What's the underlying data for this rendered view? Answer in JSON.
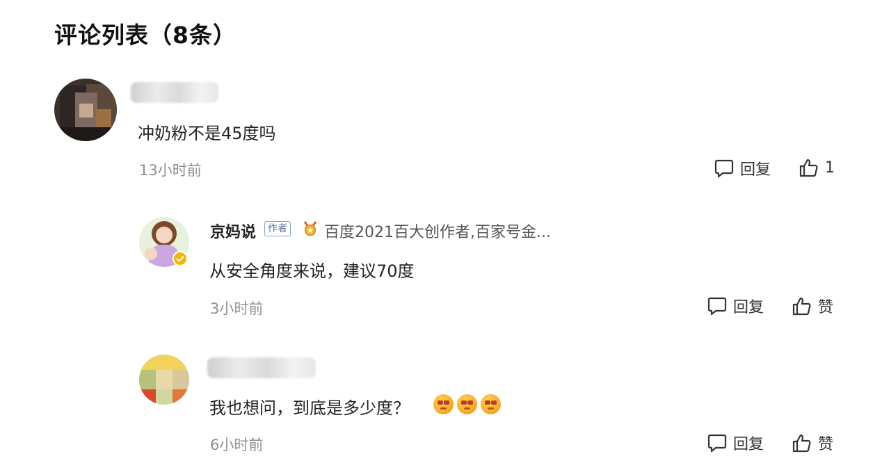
{
  "header": {
    "title": "评论列表（8条）"
  },
  "comments": [
    {
      "content": "冲奶粉不是45度吗",
      "time": "13小时前",
      "reply_label": "回复",
      "like_label": "1"
    },
    {
      "author": "京妈说",
      "author_tag": "作者",
      "honor": "百度2021百大创作者,百家号金...",
      "content": "从安全角度来说，建议70度",
      "time": "3小时前",
      "reply_label": "回复",
      "like_label": "赞"
    },
    {
      "content": "我也想问，到底是多少度？",
      "time": "6小时前",
      "reply_label": "回复",
      "like_label": "赞"
    }
  ],
  "icons": {
    "reply": "comment-bubble-icon",
    "like": "thumbs-up-icon",
    "medal": "medal-icon",
    "verified": "verified-badge-icon",
    "emoji": "blushing-face-icon"
  },
  "colors": {
    "time": "#8f8f8f",
    "verified": "#f5b400",
    "tag": "#5a6ea0"
  }
}
